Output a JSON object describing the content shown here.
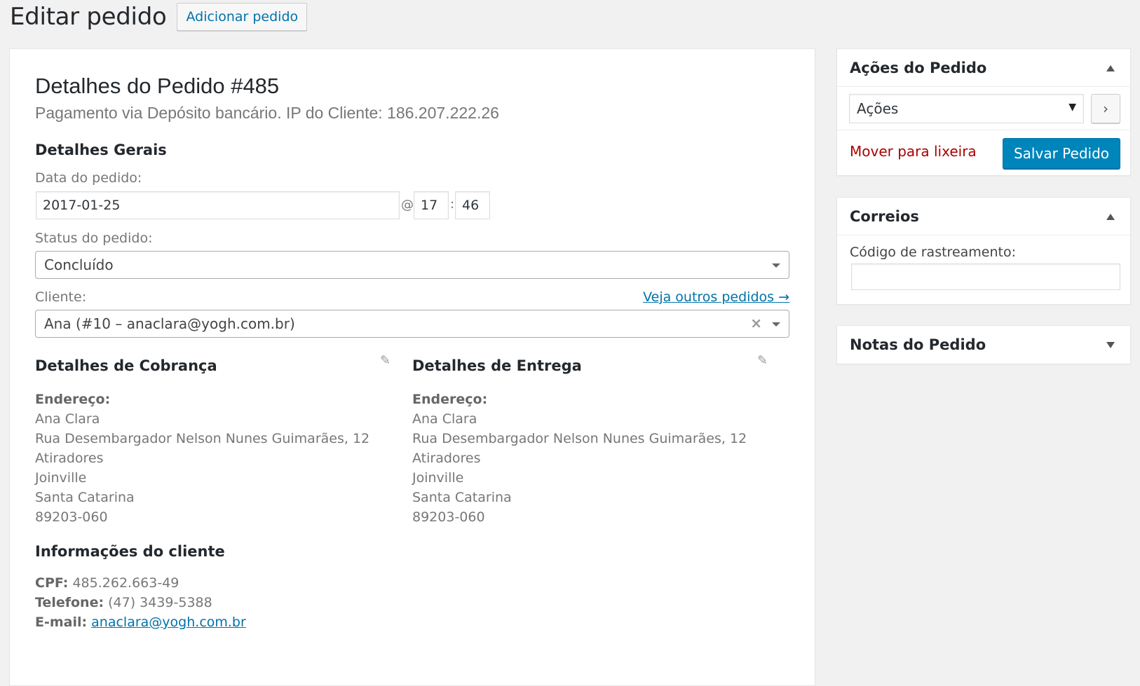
{
  "header": {
    "title": "Editar pedido",
    "add_button": "Adicionar pedido"
  },
  "order": {
    "title": "Detalhes do Pedido #485",
    "subtitle": "Pagamento via Depósito bancário. IP do Cliente: 186.207.222.26",
    "general": {
      "heading": "Detalhes Gerais",
      "date_label": "Data do pedido:",
      "date_value": "2017-01-25",
      "at_sign": "@",
      "hour": "17",
      "colon": ":",
      "minute": "46",
      "status_label": "Status do pedido:",
      "status_value": "Concluído",
      "customer_label": "Cliente:",
      "customer_link": "Veja outros pedidos →",
      "customer_value": "Ana (#10 – anaclara@yogh.com.br)",
      "clear_icon": "×"
    },
    "billing": {
      "heading": "Detalhes de Cobrança",
      "address_label": "Endereço:",
      "lines": [
        "Ana Clara",
        "Rua Desembargador Nelson Nunes Guimarães, 12",
        "Atiradores",
        "Joinville",
        "Santa Catarina",
        "89203-060"
      ]
    },
    "shipping": {
      "heading": "Detalhes de Entrega",
      "address_label": "Endereço:",
      "lines": [
        "Ana Clara",
        "Rua Desembargador Nelson Nunes Guimarães, 12",
        "Atiradores",
        "Joinville",
        "Santa Catarina",
        "89203-060"
      ]
    },
    "customer_info": {
      "heading": "Informações do cliente",
      "cpf_label": "CPF:",
      "cpf_value": "485.262.663-49",
      "phone_label": "Telefone:",
      "phone_value": "(47) 3439-5388",
      "email_label": "E-mail:",
      "email_value": "anaclara@yogh.com.br"
    }
  },
  "sidebar": {
    "actions_box": {
      "title": "Ações do Pedido",
      "select_value": "Ações",
      "go_icon": "›",
      "trash_link": "Mover para lixeira",
      "save_button": "Salvar Pedido"
    },
    "correios_box": {
      "title": "Correios",
      "tracking_label": "Código de rastreamento:",
      "tracking_value": ""
    },
    "notes_box": {
      "title": "Notas do Pedido"
    }
  },
  "icons": {
    "edit": "pencil-icon",
    "collapse": "triangle-up-icon",
    "expand": "triangle-down-icon"
  },
  "colors": {
    "link": "#0073aa",
    "primary_button": "#0085ba",
    "danger_link": "#a00",
    "background": "#f1f1f1"
  }
}
